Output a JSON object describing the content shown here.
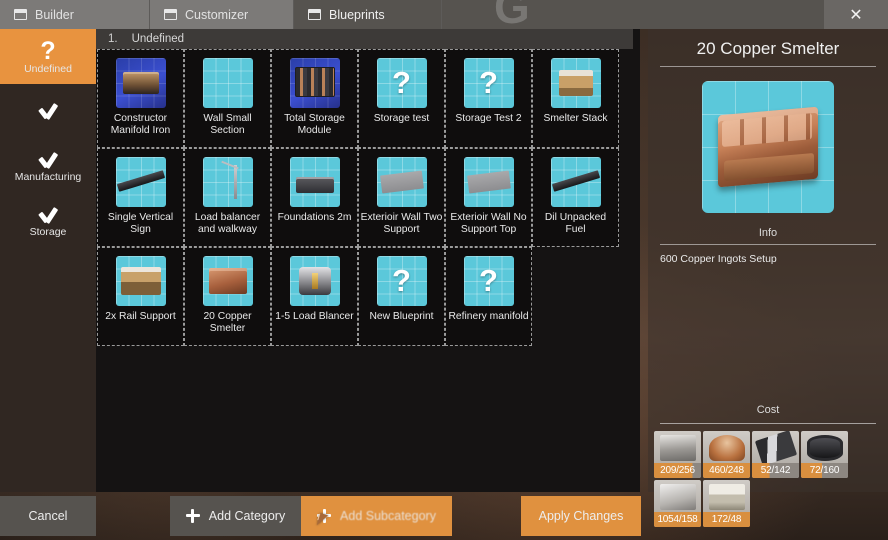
{
  "window": {
    "close_label": "✕",
    "watermark": "G"
  },
  "tabs": [
    {
      "label": "Builder",
      "icon": "window-icon",
      "active": false
    },
    {
      "label": "Customizer",
      "icon": "window-icon",
      "active": false
    },
    {
      "label": "Blueprints",
      "icon": "window-icon",
      "active": true
    }
  ],
  "sidebar": {
    "items": [
      {
        "label": "Undefined",
        "icon": "question-mark-icon",
        "selected": true
      },
      {
        "label": "",
        "icon": "check-icon",
        "selected": false
      },
      {
        "label": "Manufacturing",
        "icon": "check-icon",
        "selected": false
      },
      {
        "label": "Storage",
        "icon": "check-icon",
        "selected": false
      }
    ]
  },
  "section": {
    "number": "1.",
    "title": "Undefined"
  },
  "blueprints": [
    {
      "name": "Constructor Manifold Iron",
      "thumb": "machine"
    },
    {
      "name": "Wall Small Section",
      "thumb": "grid"
    },
    {
      "name": "Total Storage Module",
      "thumb": "rack"
    },
    {
      "name": "Storage test",
      "thumb": "question"
    },
    {
      "name": "Storage Test 2",
      "thumb": "question"
    },
    {
      "name": "Smelter Stack",
      "thumb": "smelter"
    },
    {
      "name": "Single Vertical Sign",
      "thumb": "beam"
    },
    {
      "name": "Load balancer and walkway",
      "thumb": "pole"
    },
    {
      "name": "Foundations 2m",
      "thumb": "slab"
    },
    {
      "name": "Exterioir Wall Two Support",
      "thumb": "wall"
    },
    {
      "name": "Exterioir Wall No Support Top",
      "thumb": "wall"
    },
    {
      "name": "Dil Unpacked Fuel",
      "thumb": "beam"
    },
    {
      "name": "2x Rail Support",
      "thumb": "rail"
    },
    {
      "name": "20 Copper Smelter",
      "thumb": "copper"
    },
    {
      "name": "1-5 Load Blancer",
      "thumb": "cylinder"
    },
    {
      "name": "New Blueprint",
      "thumb": "question"
    },
    {
      "name": "Refinery manifold",
      "thumb": "question"
    }
  ],
  "detail": {
    "title": "20 Copper Smelter",
    "info_label": "Info",
    "info_text": "600 Copper Ingots Setup",
    "cost_label": "Cost",
    "cost_items": [
      {
        "qty": "209/256",
        "icon": "reinforced-iron-plate-icon",
        "fill": "partial"
      },
      {
        "qty": "460/248",
        "icon": "copper-wire-icon",
        "fill": "full"
      },
      {
        "qty": "52/142",
        "icon": "iron-rod-icon",
        "fill": "partial-mid"
      },
      {
        "qty": "72/160",
        "icon": "pipe-icon",
        "fill": "partial-low"
      },
      {
        "qty": "1054/158",
        "icon": "iron-plate-icon",
        "fill": "full"
      },
      {
        "qty": "172/48",
        "icon": "concrete-icon",
        "fill": "full"
      }
    ]
  },
  "bottom_bar": {
    "cancel": "Cancel",
    "add_category": "Add Category",
    "add_subcategory": "Add Subcategory",
    "apply_changes": "Apply Changes"
  }
}
